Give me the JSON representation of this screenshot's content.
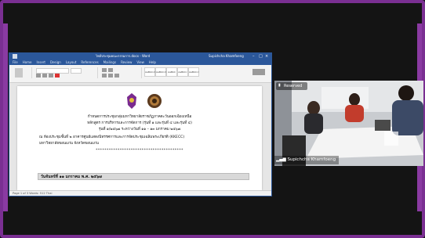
{
  "colors": {
    "frame": "#7a2f92",
    "background": "#141414",
    "word_blue": "#2b579a"
  },
  "word": {
    "title": "ไฟล์ประชุมคณะกรรมการ.docx - Word",
    "user": "Supichcha Khamfoeng",
    "menu": [
      "File",
      "Home",
      "Insert",
      "Design",
      "Layout",
      "References",
      "Mailings",
      "Review",
      "View",
      "Help"
    ],
    "styles": [
      "AaBbCcDd",
      "AaBbCcDd",
      "AaBbC",
      "AaBbCc",
      "AaBbCcI"
    ],
    "document": {
      "line1": "กำหนดการประชุมกลุ่มมหาวิทยาลัยราชภัฏภาคตะวันออกเฉียงเหนือ",
      "line2": "หลักสูตร การบริหารและการจัดการ (รุ่นที่ ๑ และรุ่นที่ ๔ และรุ่นที่ ๔)",
      "line3": "รุ่นที่ ๑/๒๕๖๗ ระหว่างวันที่ ๑๑ – ๑๓ มกราคม ๒๕๖๗",
      "line4": "ณ ห้องประชุมชั้นที่ ๒ อาคารศูนย์แสดงนิทรรศการและการจัดประชุมเฉลิมพระเกียรติ (KKECC)",
      "line5": "มหาวิทยาลัยขอนแก่น จังหวัดขอนแก่น",
      "stars": "****************************************",
      "date_bar": "วันจันทร์ที่ ๑๑ มกราคม พ.ศ. ๒๕๖๗"
    },
    "status": "Page 1 of 3   Words: 512   Thai"
  },
  "video": {
    "label": "Reserved",
    "name": "Supichcha Khamfoeng"
  }
}
